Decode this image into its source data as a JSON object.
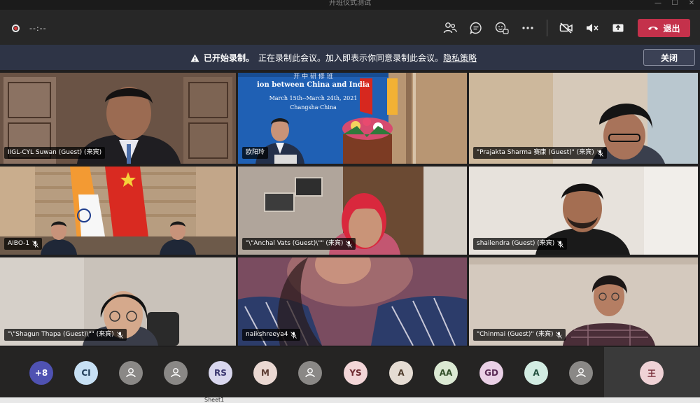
{
  "window": {
    "title": "开班仪式测试",
    "controls": [
      "—",
      "☐",
      "✕"
    ]
  },
  "toolbar": {
    "timer": "--:--",
    "leave_label": "退出",
    "icons": [
      "participants-icon",
      "chat-icon",
      "reactions-icon",
      "more-options-icon",
      "camera-off-icon",
      "mute-icon",
      "share-icon"
    ]
  },
  "banner": {
    "title": "已开始录制。",
    "message": "正在录制此会议。加入即表示你同意录制此会议。",
    "link": "隐私策略",
    "close_label": "关闭"
  },
  "participants": [
    {
      "name": "IIGL-CYL Suwan (Guest) (来宾)",
      "muted": false
    },
    {
      "name": "欧阳玲",
      "muted": false
    },
    {
      "name": "\"Prajakta Sharma 赛康 (Guest)\" (来宾)",
      "muted": true
    },
    {
      "name": "AIBO-1",
      "muted": true
    },
    {
      "name": "\"\\\"Anchal Vats (Guest)\\\"\" (来宾)",
      "muted": true
    },
    {
      "name": "shailendra (Guest) (来宾)",
      "muted": true
    },
    {
      "name": "\"\\\"Shagun Thapa (Guest)\\\"\" (来宾)",
      "muted": true
    },
    {
      "name": "naikshreeya4",
      "muted": true
    },
    {
      "name": "\"Chinmai (Guest)\" (来宾)",
      "muted": true
    }
  ],
  "slide": {
    "line1": "ion between China and India",
    "line2": "March 15th--March 24th, 2021",
    "line3": "Changsha·China",
    "top_partial": "开 中 研 修 班"
  },
  "roster": [
    {
      "initials": "+8",
      "bg": "#4f52b2",
      "fg": "#ffffff"
    },
    {
      "initials": "CI",
      "bg": "#c7e0f4",
      "fg": "#1f3b57"
    },
    {
      "initials": "",
      "bg": "#8a8886",
      "fg": "#ffffff",
      "icon": "person-icon"
    },
    {
      "initials": "",
      "bg": "#8a8886",
      "fg": "#ffffff",
      "icon": "person-icon"
    },
    {
      "initials": "RS",
      "bg": "#d9d7ee",
      "fg": "#3a3670"
    },
    {
      "initials": "M",
      "bg": "#ead8d2",
      "fg": "#5a3a30"
    },
    {
      "initials": "",
      "bg": "#8a8886",
      "fg": "#ffffff",
      "icon": "person-icon"
    },
    {
      "initials": "YS",
      "bg": "#f3d6d8",
      "fg": "#6e2a30"
    },
    {
      "initials": "A",
      "bg": "#e5dcd3",
      "fg": "#4e3b2b"
    },
    {
      "initials": "AA",
      "bg": "#dbe9d3",
      "fg": "#33502a"
    },
    {
      "initials": "GD",
      "bg": "#ead0e6",
      "fg": "#5a2a55"
    },
    {
      "initials": "A",
      "bg": "#d2ece2",
      "fg": "#22503e"
    },
    {
      "initials": "",
      "bg": "#8a8886",
      "fg": "#ffffff",
      "icon": "person-icon"
    },
    {
      "initials": "王",
      "bg": "#efd2d6",
      "fg": "#7a2f3b"
    }
  ],
  "taskbar": {
    "sheet_label": "Sheet1"
  }
}
